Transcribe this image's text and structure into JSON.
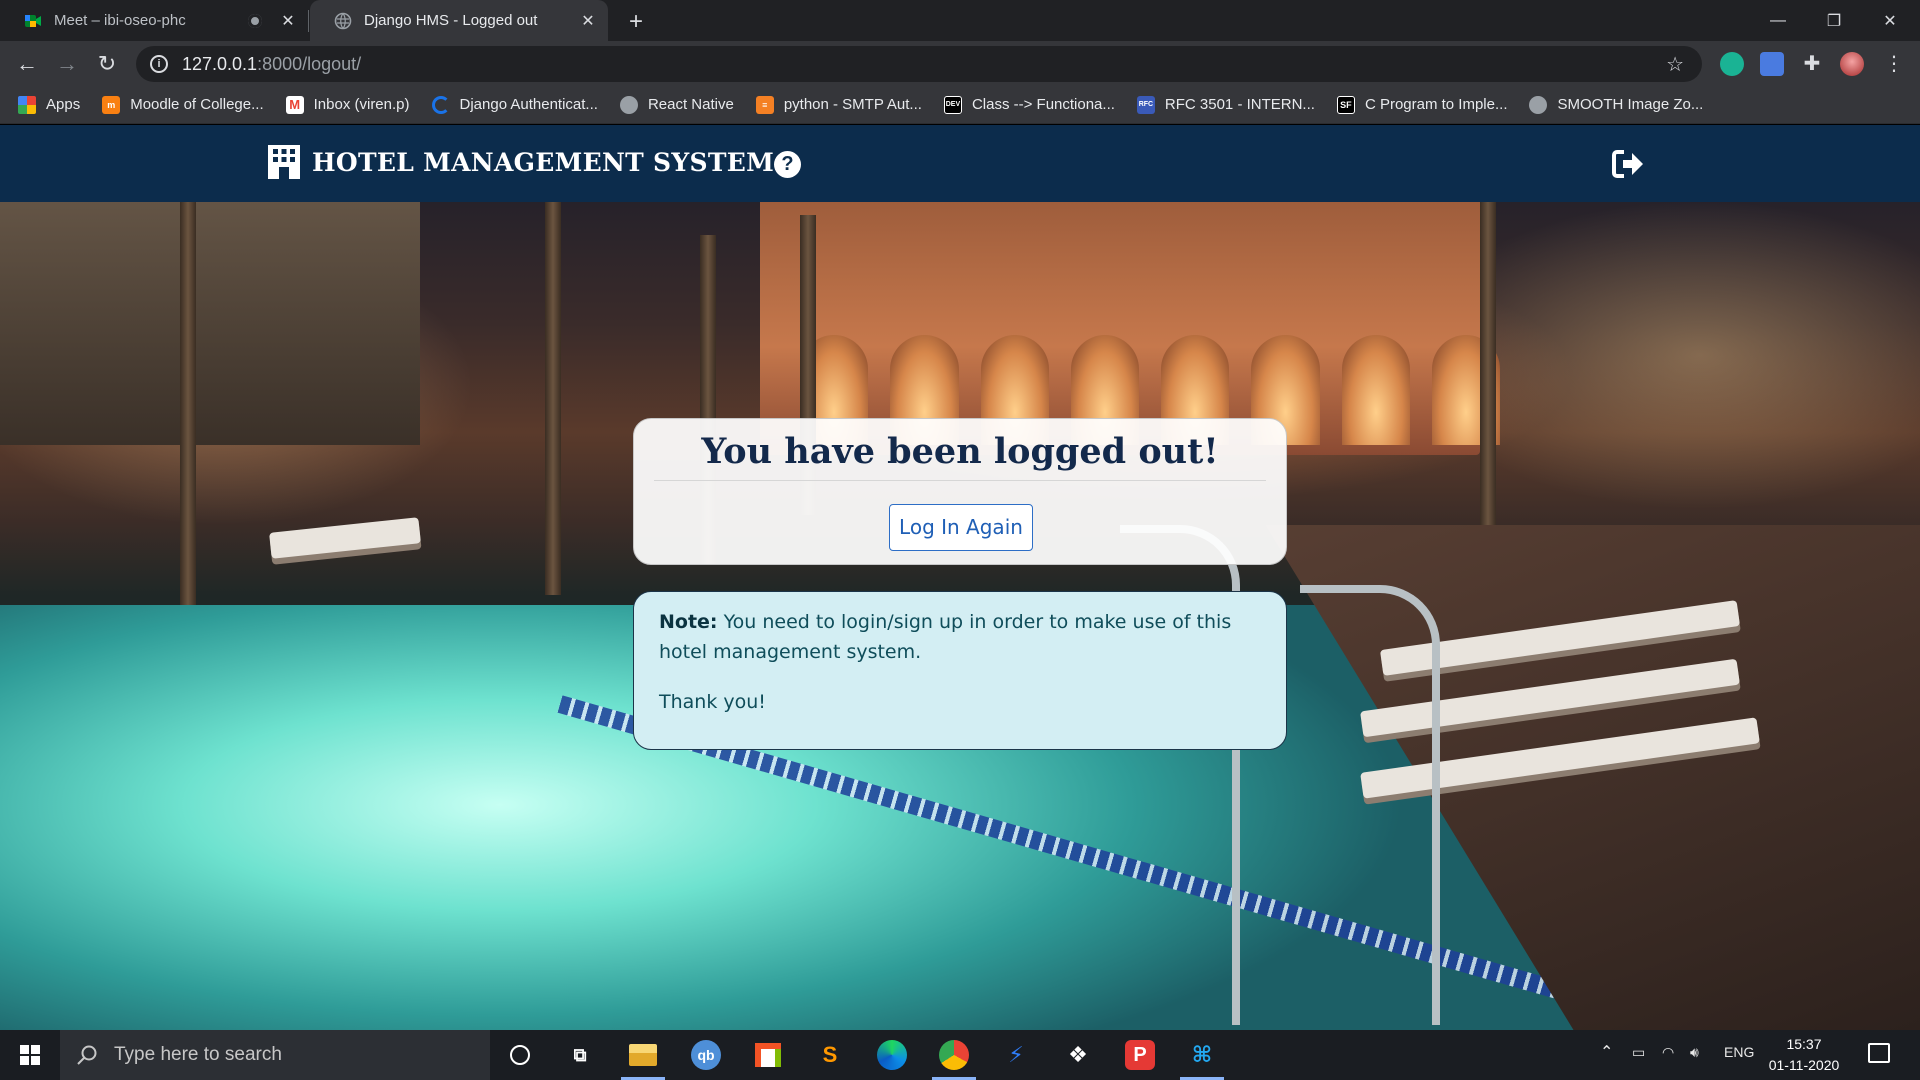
{
  "browser": {
    "tabs": [
      {
        "title": "Meet – ibi-oseo-phc",
        "active": false
      },
      {
        "title": "Django HMS - Logged out",
        "active": true
      }
    ],
    "url_host": "127.0.0.1",
    "url_rest": ":8000/logout/",
    "bookmarks": [
      {
        "label": "Apps",
        "icon": "apps-grid-icon",
        "color": "#ea4335"
      },
      {
        "label": "Moodle of College...",
        "icon": "moodle-icon",
        "color": "#f98012"
      },
      {
        "label": "Inbox (viren.p)",
        "icon": "gmail-icon",
        "color": "#ea4335"
      },
      {
        "label": "Django Authenticat...",
        "icon": "loading-icon",
        "color": "#1a73e8"
      },
      {
        "label": "React Native",
        "icon": "globe-icon",
        "color": "#9aa0a6"
      },
      {
        "label": "python - SMTP Aut...",
        "icon": "stackoverflow-icon",
        "color": "#f48024"
      },
      {
        "label": "Class --> Functiona...",
        "icon": "dev-icon",
        "color": "#000000"
      },
      {
        "label": "RFC 3501 - INTERN...",
        "icon": "ietf-icon",
        "color": "#3a5ab8"
      },
      {
        "label": "C Program to Imple...",
        "icon": "sf-icon",
        "color": "#000000"
      },
      {
        "label": "SMOOTH Image Zo...",
        "icon": "globe-icon",
        "color": "#9aa0a6"
      }
    ]
  },
  "site": {
    "brand": "HOTEL MANAGEMENT SYSTEM",
    "logout_heading": "You have been logged out!",
    "login_again_label": "Log In Again",
    "note_label": "Note:",
    "note_text": "You need to login/sign up in order to make use of this hotel management system.",
    "thanks_text": "Thank you!",
    "colors": {
      "navbar": "#0c2c4c",
      "heading": "#13294b",
      "note_bg": "#d3eef3",
      "button": "#1f5fb6"
    }
  },
  "taskbar": {
    "search_placeholder": "Type here to search",
    "apps": [
      "cortana-icon",
      "task-view-icon",
      "file-explorer-icon",
      "qbittorrent-icon",
      "store-icon",
      "sublime-text-icon",
      "edge-icon",
      "chrome-icon",
      "power-automate-icon",
      "dropbox-icon",
      "proxy-app-icon",
      "vscode-icon"
    ],
    "lang": "ENG",
    "time": "15:37",
    "date": "01-11-2020"
  }
}
